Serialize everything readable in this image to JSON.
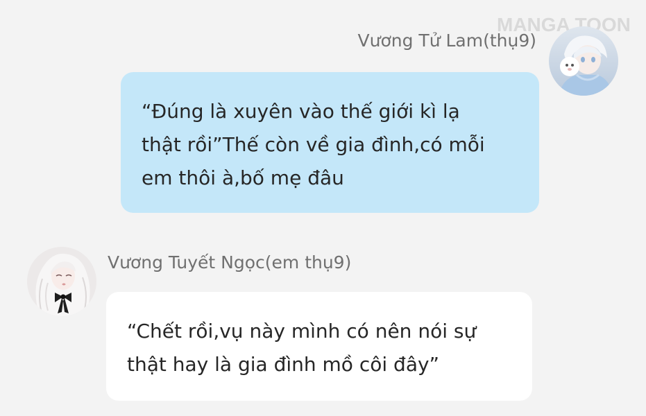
{
  "watermark": {
    "text": "MANGA TOON"
  },
  "messages": [
    {
      "side": "right",
      "sender": "Vương Tử Lam(thụ9)",
      "avatar_icon": "avatar-light-hair-icon",
      "lines": [
        "“Đúng là xuyên vào thế giới kì lạ",
        "thật rồi”Thế còn về gia đình,có mỗi",
        "em thôi à,bố mẹ đâu"
      ],
      "bubble_color": "#c4e7f9"
    },
    {
      "side": "left",
      "sender": "Vương Tuyết Ngọc(em thụ9)",
      "avatar_icon": "avatar-white-hair-girl-icon",
      "lines": [
        "“Chết rồi,vụ này mình có nên nói sự",
        "thật hay là gia đình mồ côi đây”"
      ],
      "bubble_color": "#ffffff"
    }
  ],
  "colors": {
    "background": "#f3f3f3",
    "name_text": "#707070",
    "message_text": "#262626",
    "watermark": "#d9d9d9"
  }
}
